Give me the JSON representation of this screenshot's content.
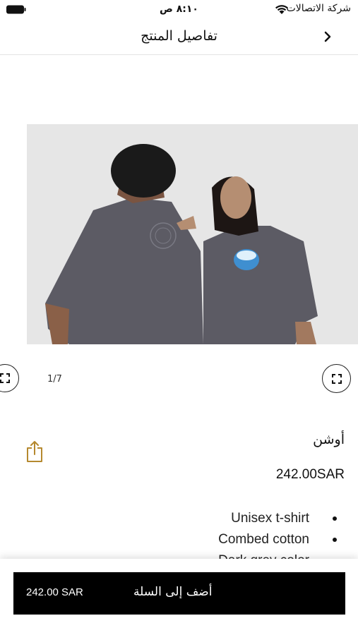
{
  "status_bar": {
    "time": "٨:١٠ ص",
    "carrier": "شركة الاتصالات",
    "icons": [
      "battery-icon",
      "wifi-icon"
    ]
  },
  "nav": {
    "title": "تفاصيل المنتج",
    "back_icon": "chevron-right-icon"
  },
  "gallery": {
    "image": "two-models-grey-tshirt-photo",
    "counter": "1/7",
    "expand_icon": "expand-icon"
  },
  "product": {
    "name": "أوشن",
    "price": "242.00SAR",
    "share_icon": "share-icon",
    "features": [
      "Unisex t-shirt",
      "Combed cotton",
      "Dark grey color"
    ]
  },
  "cart": {
    "price": "242.00 SAR",
    "label": "أضف إلى السلة"
  },
  "colors": {
    "accent": "#b5892f",
    "button": "#000000",
    "shirt": "#5c5b64"
  }
}
